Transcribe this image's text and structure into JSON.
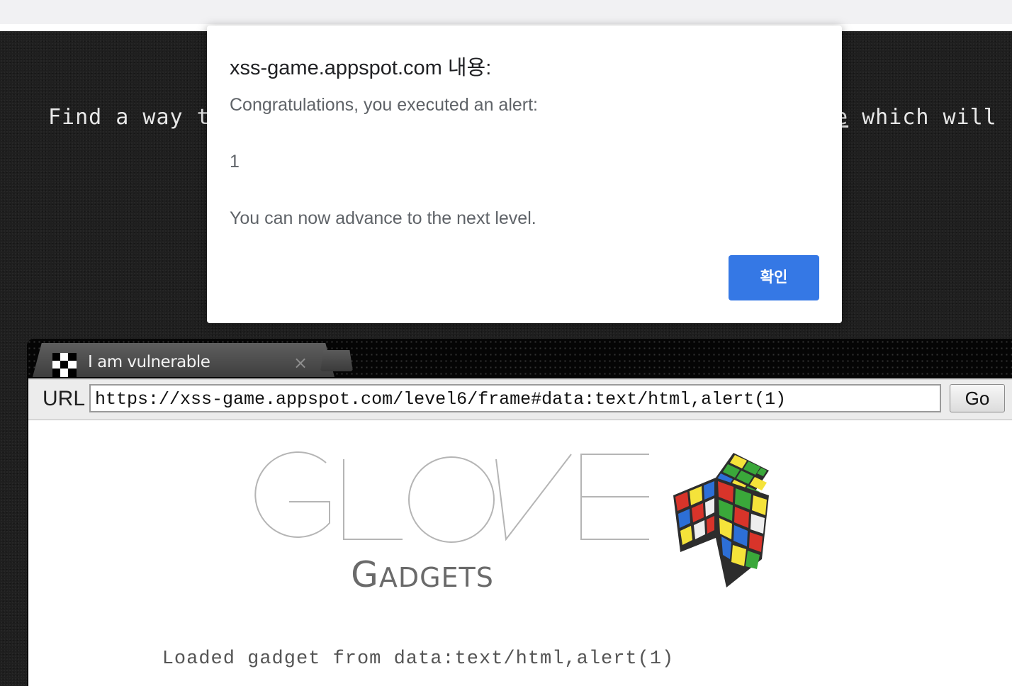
{
  "page": {
    "mission_left": "Find a way t",
    "mission_right_link": "e",
    "mission_right_rest": " which will"
  },
  "frame": {
    "tab_title": "I am vulnerable",
    "tab_close": "×",
    "url_label": "URL",
    "url_value": "https://xss-game.appspot.com/level6/frame#data:text/html,alert(1)",
    "go_label": "Go",
    "logo_alt": "GLOVE GADGETS",
    "loaded_text": "Loaded gadget from data:text/html,alert(1)"
  },
  "dialog": {
    "title": "xss-game.appspot.com 내용:",
    "line1": "Congratulations, you executed an alert:",
    "line2": "1",
    "line3": "You can now advance to the next level.",
    "ok_label": "확인"
  },
  "colors": {
    "dialog_button": "#3578e5",
    "page_background": "#1f1f1f"
  }
}
